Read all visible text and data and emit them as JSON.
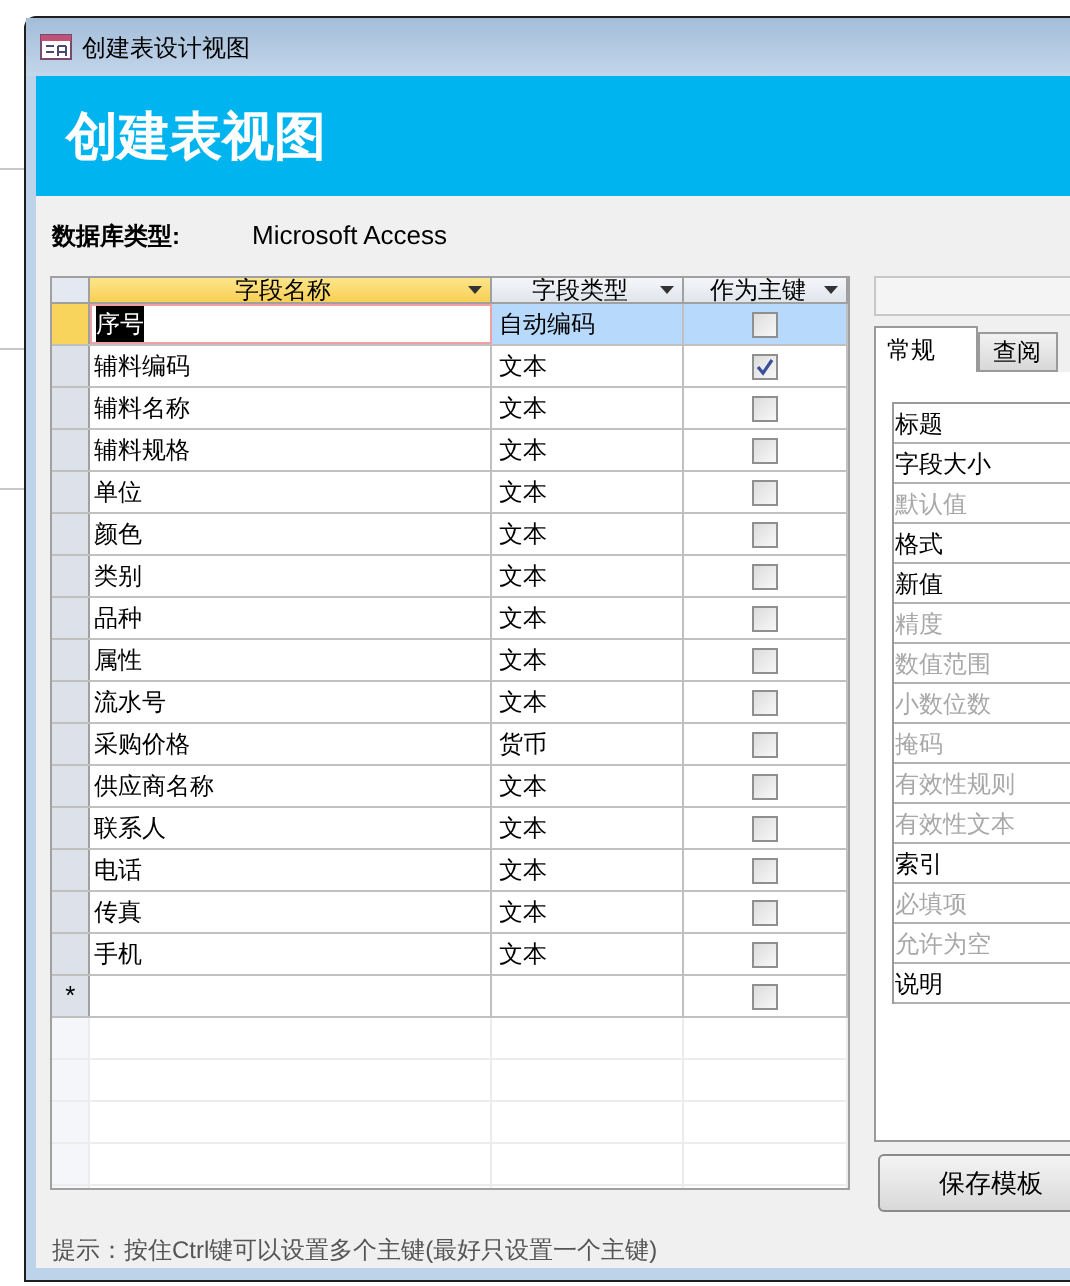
{
  "window": {
    "title": "创建表设计视图"
  },
  "header": {
    "title": "创建表视图"
  },
  "database_type": {
    "label": "数据库类型:",
    "value": "Microsoft Access"
  },
  "grid": {
    "columns": [
      {
        "label": "字段名称",
        "selected": true
      },
      {
        "label": "字段类型",
        "selected": false
      },
      {
        "label": "作为主键",
        "selected": false
      }
    ],
    "rows": [
      {
        "kind": "field",
        "name": "序号",
        "type": "自动编码",
        "primary_key": false,
        "selected": true
      },
      {
        "kind": "field",
        "name": "辅料编码",
        "type": "文本",
        "primary_key": true,
        "selected": false
      },
      {
        "kind": "field",
        "name": "辅料名称",
        "type": "文本",
        "primary_key": false,
        "selected": false
      },
      {
        "kind": "field",
        "name": "辅料规格",
        "type": "文本",
        "primary_key": false,
        "selected": false
      },
      {
        "kind": "field",
        "name": "单位",
        "type": "文本",
        "primary_key": false,
        "selected": false
      },
      {
        "kind": "field",
        "name": "颜色",
        "type": "文本",
        "primary_key": false,
        "selected": false
      },
      {
        "kind": "field",
        "name": "类别",
        "type": "文本",
        "primary_key": false,
        "selected": false
      },
      {
        "kind": "field",
        "name": "品种",
        "type": "文本",
        "primary_key": false,
        "selected": false
      },
      {
        "kind": "field",
        "name": "属性",
        "type": "文本",
        "primary_key": false,
        "selected": false
      },
      {
        "kind": "field",
        "name": "流水号",
        "type": "文本",
        "primary_key": false,
        "selected": false
      },
      {
        "kind": "field",
        "name": "采购价格",
        "type": "货币",
        "primary_key": false,
        "selected": false
      },
      {
        "kind": "field",
        "name": "供应商名称",
        "type": "文本",
        "primary_key": false,
        "selected": false
      },
      {
        "kind": "field",
        "name": "联系人",
        "type": "文本",
        "primary_key": false,
        "selected": false
      },
      {
        "kind": "field",
        "name": "电话",
        "type": "文本",
        "primary_key": false,
        "selected": false
      },
      {
        "kind": "field",
        "name": "传真",
        "type": "文本",
        "primary_key": false,
        "selected": false
      },
      {
        "kind": "field",
        "name": "手机",
        "type": "文本",
        "primary_key": false,
        "selected": false
      },
      {
        "kind": "new",
        "marker": "*",
        "primary_key": false,
        "selected": false
      }
    ]
  },
  "properties": {
    "tabs": [
      {
        "label": "常规",
        "selected": true
      },
      {
        "label": "查阅",
        "selected": false
      }
    ],
    "items": [
      {
        "label": "标题",
        "disabled": false
      },
      {
        "label": "字段大小",
        "disabled": false
      },
      {
        "label": "默认值",
        "disabled": true
      },
      {
        "label": "格式",
        "disabled": false
      },
      {
        "label": "新值",
        "disabled": false
      },
      {
        "label": "精度",
        "disabled": true
      },
      {
        "label": "数值范围",
        "disabled": true
      },
      {
        "label": "小数位数",
        "disabled": true
      },
      {
        "label": "掩码",
        "disabled": true
      },
      {
        "label": "有效性规则",
        "disabled": true
      },
      {
        "label": "有效性文本",
        "disabled": true
      },
      {
        "label": "索引",
        "disabled": false
      },
      {
        "label": "必填项",
        "disabled": true
      },
      {
        "label": "允许为空",
        "disabled": true
      },
      {
        "label": "说明",
        "disabled": false
      }
    ]
  },
  "save_button": "保存模板",
  "hint": "提示：按住Ctrl键可以设置多个主键(最好只设置一个主键)"
}
